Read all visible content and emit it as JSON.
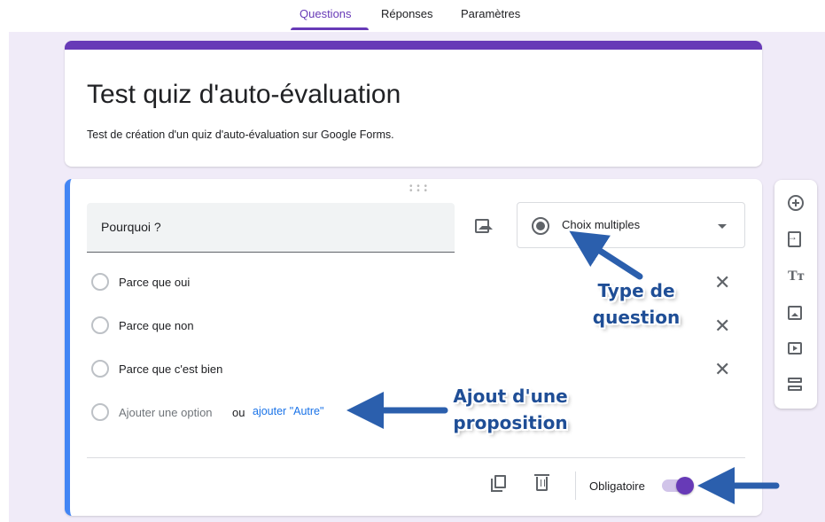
{
  "tabs": [
    {
      "label": "Questions",
      "active": true
    },
    {
      "label": "Réponses",
      "active": false
    },
    {
      "label": "Paramètres",
      "active": false
    }
  ],
  "form": {
    "title": "Test quiz d'auto-évaluation",
    "description": "Test de création d'un quiz d'auto-évaluation sur Google Forms."
  },
  "question": {
    "text": "Pourquoi ?",
    "type": "Choix multiples",
    "options": [
      "Parce que oui",
      "Parce que non",
      "Parce que c'est bien"
    ],
    "add_option": "Ajouter une option",
    "or": "ou",
    "add_other": "ajouter \"Autre\"",
    "required_label": "Obligatoire",
    "required": true
  },
  "toolbar": {
    "icons": [
      "add-question-icon",
      "import-questions-icon",
      "add-title-icon",
      "add-image-icon",
      "add-video-icon",
      "add-section-icon"
    ]
  },
  "annotations": {
    "type": [
      "Type de",
      "question"
    ],
    "proposition": [
      "Ajout d'une",
      "proposition"
    ]
  },
  "colors": {
    "accent": "#673ab7",
    "focus_border": "#4285f4",
    "link": "#1a73e8",
    "background": "#f0ebf8",
    "annotation": "#1f4e96"
  }
}
